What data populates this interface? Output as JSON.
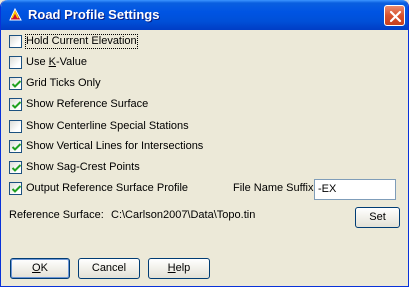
{
  "window": {
    "title": "Road Profile Settings",
    "titlebar_color": "#0054E3"
  },
  "options": [
    {
      "label_pre": "",
      "label_key": "",
      "label_post": "Hold Current Elevation",
      "checked": false,
      "focused": true
    },
    {
      "label_pre": "Use ",
      "label_key": "K",
      "label_post": "-Value",
      "checked": false,
      "focused": false
    },
    {
      "label_pre": "",
      "label_key": "",
      "label_post": "Grid Ticks Only",
      "checked": true,
      "focused": false
    },
    {
      "label_pre": "",
      "label_key": "",
      "label_post": "Show Reference Surface",
      "checked": true,
      "focused": false
    },
    {
      "label_pre": "",
      "label_key": "",
      "label_post": "Show Centerline Special Stations",
      "checked": false,
      "focused": false
    },
    {
      "label_pre": "",
      "label_key": "",
      "label_post": "Show Vertical Lines for Intersections",
      "checked": true,
      "focused": false
    },
    {
      "label_pre": "",
      "label_key": "",
      "label_post": "Show Sag-Crest Points",
      "checked": true,
      "focused": false
    },
    {
      "label_pre": "",
      "label_key": "",
      "label_post": "Output Reference Surface Profile",
      "checked": true,
      "focused": false
    }
  ],
  "file_suffix": {
    "label": "File Name Suffix:",
    "value": "-EX"
  },
  "reference_surface": {
    "label": "Reference Surface:",
    "path": "C:\\Carlson2007\\Data\\Topo.tin"
  },
  "buttons": {
    "set": "Set",
    "ok_key": "O",
    "ok_rest": "K",
    "cancel": "Cancel",
    "help_key": "H",
    "help_rest": "elp"
  }
}
